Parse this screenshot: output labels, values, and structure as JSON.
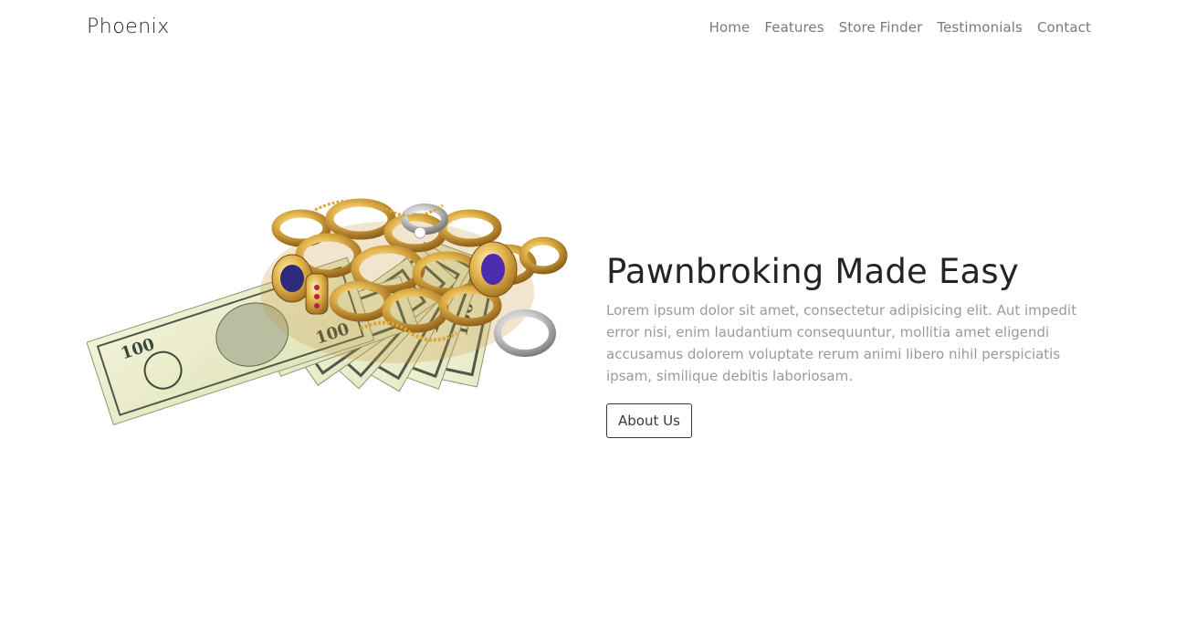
{
  "navbar": {
    "brand": "Phoenix",
    "links": [
      {
        "label": "Home"
      },
      {
        "label": "Features"
      },
      {
        "label": "Store Finder"
      },
      {
        "label": "Testimonials"
      },
      {
        "label": "Contact"
      }
    ]
  },
  "hero": {
    "title": "Pawnbroking Made Easy",
    "lead": "Lorem ipsum dolor sit amet, consectetur adipisicing elit. Aut impedit error nisi, enim laudantium consequuntur, mollitia amet eligendi accusamus dolorem voluptate rerum animi libero nihil perspiciatis ipsam, similique debitis laboriosam.",
    "button_label": "About Us",
    "image": {
      "icon": "gold-jewelry-on-dollar-bills",
      "banknote_denomination": "100"
    }
  },
  "colors": {
    "title": "#212529",
    "lead": "#9a9a9a",
    "nav_link": "#7a7a7a",
    "button_border": "#343a40",
    "gold": "#d4a23a",
    "banknote": "#e9ebc8"
  }
}
